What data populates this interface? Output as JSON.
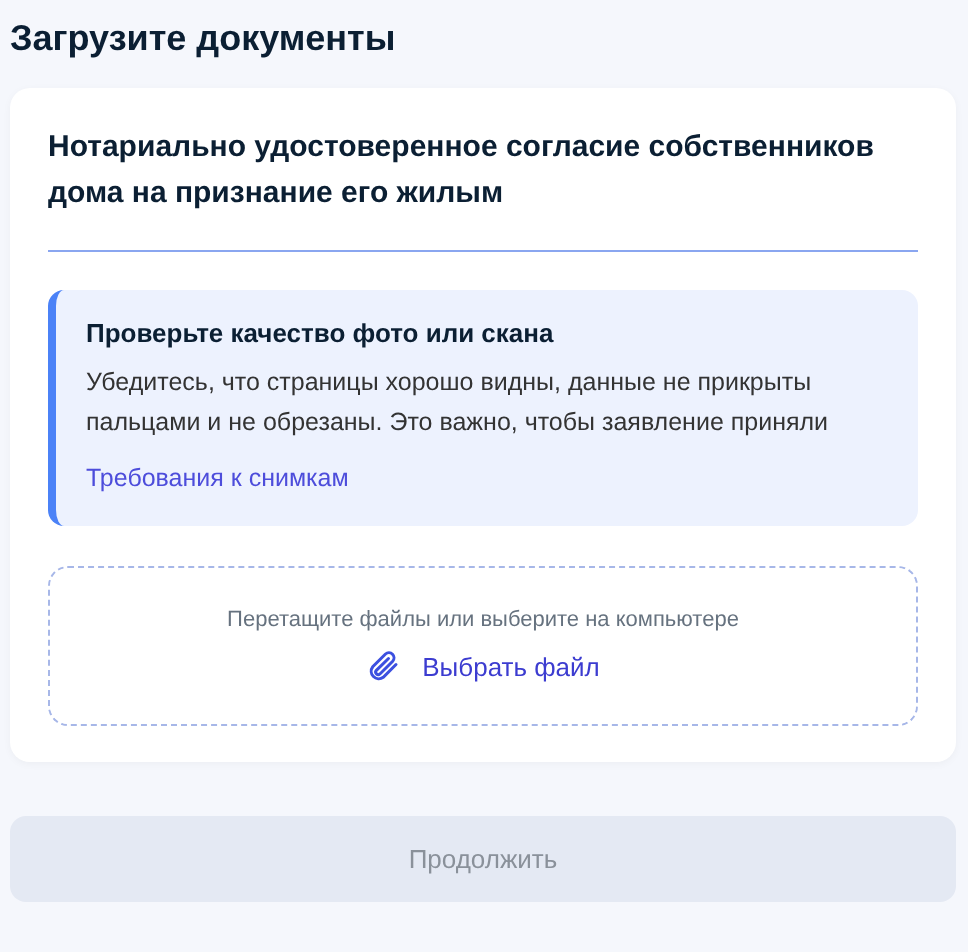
{
  "page_title": "Загрузите документы",
  "document": {
    "title": "Нотариально удостоверенное согласие собственников дома на признание его жилым",
    "notice": {
      "title": "Проверьте качество фото или скана",
      "text": "Убедитесь, что страницы хорошо видны, данные не прикрыты пальцами и не обрезаны. Это важно, чтобы заявление приняли",
      "link": "Требования к снимкам"
    },
    "upload": {
      "hint": "Перетащите файлы или выберите на компьютере",
      "button": "Выбрать файл"
    }
  },
  "continue_button": {
    "label": "Продолжить",
    "disabled": true
  }
}
